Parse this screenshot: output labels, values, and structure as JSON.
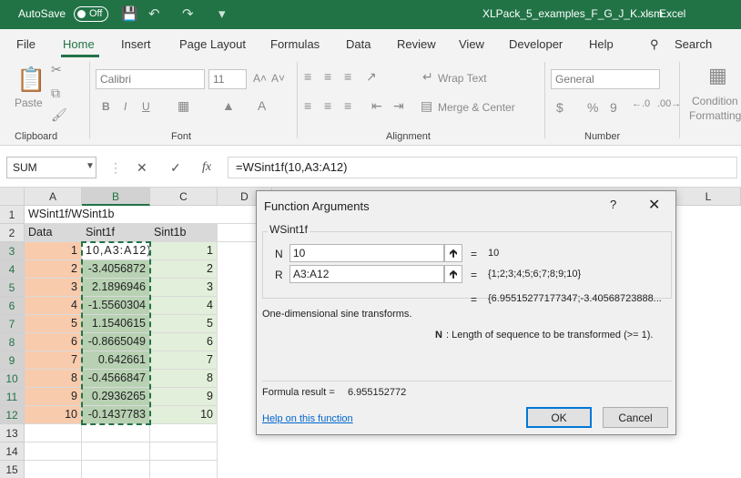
{
  "titlebar": {
    "autosave_label": "AutoSave",
    "autosave_state": "Off",
    "filename": "XLPack_5_examples_F_G_J_K.xlsm",
    "separator": "-",
    "app": "Excel"
  },
  "tabs": [
    "File",
    "Home",
    "Insert",
    "Page Layout",
    "Formulas",
    "Data",
    "Review",
    "View",
    "Developer",
    "Help"
  ],
  "search_label": "Search",
  "ribbon": {
    "clipboard": {
      "label": "Clipboard",
      "paste": "Paste"
    },
    "font": {
      "label": "Font",
      "font_name": "Calibri",
      "font_size": "11",
      "grow": "A˄",
      "shrink": "A˅",
      "bold": "B",
      "italic": "I",
      "underline": "U"
    },
    "alignment": {
      "label": "Alignment",
      "wrap_text": "Wrap Text",
      "merge_center": "Merge & Center"
    },
    "number": {
      "label": "Number",
      "format": "General",
      "currency": "$",
      "percent": "%",
      "comma": "9"
    },
    "styles": {
      "conditional": "Condition",
      "formatting": "Formatting"
    }
  },
  "formula_bar": {
    "name_box": "SUM",
    "formula": "=WSint1f(10,A3:A12)",
    "fx": "fx"
  },
  "grid": {
    "col_headers": [
      "A",
      "B",
      "C",
      "D",
      "L"
    ],
    "row_headers": [
      "1",
      "2",
      "3",
      "4",
      "5",
      "6",
      "7",
      "8",
      "9",
      "10",
      "11",
      "12",
      "13",
      "14",
      "15"
    ],
    "a1": "WSint1f/WSint1b",
    "headers": [
      "Data",
      "Sint1f",
      "Sint1b"
    ],
    "data": [
      "1",
      "2",
      "3",
      "4",
      "5",
      "6",
      "7",
      "8",
      "9",
      "10"
    ],
    "sint1f": [
      "10,A3:A12)",
      "-3.4056872",
      "2.1896946",
      "-1.5560304",
      "1.1540615",
      "-0.8665049",
      "0.642661",
      "-0.4566847",
      "0.2936265",
      "-0.1437783"
    ],
    "sint1b": [
      "1",
      "2",
      "3",
      "4",
      "5",
      "6",
      "7",
      "8",
      "9",
      "10"
    ]
  },
  "dialog": {
    "title": "Function Arguments",
    "help_icon": "?",
    "function_name": "WSint1f",
    "args": [
      {
        "label": "N",
        "value": "10",
        "result": "10"
      },
      {
        "label": "R",
        "value": "A3:A12",
        "result": "{1;2;3;4;5;6;7;8;9;10}"
      }
    ],
    "eq": "=",
    "overall_result": "{6.95515277177347;-3.40568723888...",
    "description": "One-dimensional sine transforms.",
    "arg_help_name": "N",
    "arg_help_text": ": Length of sequence to be transformed (>= 1).",
    "formula_result_label": "Formula result =",
    "formula_result_value": "6.955152772",
    "help_link": "Help on this function",
    "ok": "OK",
    "cancel": "Cancel"
  }
}
